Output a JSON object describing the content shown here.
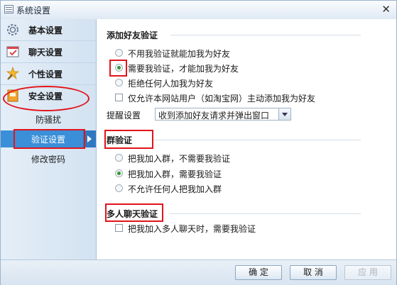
{
  "window": {
    "title": "系统设置"
  },
  "sidebar": {
    "items": [
      {
        "label": "基本设置",
        "icon": "gear-icon"
      },
      {
        "label": "聊天设置",
        "icon": "chat-window-icon"
      },
      {
        "label": "个性设置",
        "icon": "star-wand-icon"
      },
      {
        "label": "安全设置",
        "icon": "lock-icon"
      }
    ],
    "sub_items": [
      {
        "label": "防骚扰",
        "selected": false
      },
      {
        "label": "验证设置",
        "selected": true
      },
      {
        "label": "修改密码",
        "selected": false
      }
    ]
  },
  "friend_verify": {
    "title": "添加好友验证",
    "options": [
      {
        "label": "不用我验证就能加我为好友",
        "checked": false
      },
      {
        "label": "需要我验证，才能加我为好友",
        "checked": true
      },
      {
        "label": "拒绝任何人加我为好友",
        "checked": false
      }
    ],
    "taobao_only": {
      "label": "仅允许本网站用户（如淘宝网）主动添加我为好友",
      "checked": false
    },
    "reminder": {
      "label": "提醒设置",
      "value": "收到添加好友请求并弹出窗口"
    }
  },
  "group_verify": {
    "title": "群验证",
    "options": [
      {
        "label": "把我加入群，不需要我验证",
        "checked": false
      },
      {
        "label": "把我加入群，需要我验证",
        "checked": true
      },
      {
        "label": "不允许任何人把我加入群",
        "checked": false
      }
    ]
  },
  "multi_chat_verify": {
    "title": "多人聊天验证",
    "option": {
      "label": "把我加入多人聊天时，需要我验证",
      "checked": false
    }
  },
  "footer": {
    "ok": "确 定",
    "cancel": "取 消",
    "apply": "应 用"
  },
  "colors": {
    "accent": "#3b8fd8",
    "annotation": "#e2141b",
    "radio_checked": "#2a9b2a"
  }
}
